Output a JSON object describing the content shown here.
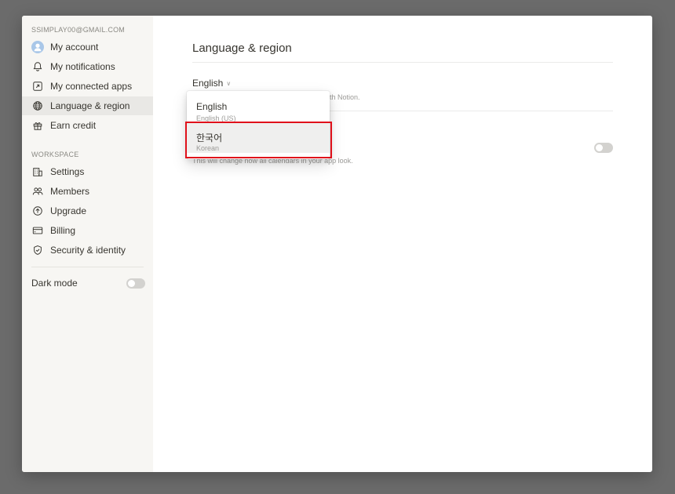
{
  "sidebar": {
    "account_email": "SSIMPLAY00@GMAIL.COM",
    "account_items": [
      {
        "label": "My account",
        "icon": "avatar-icon"
      },
      {
        "label": "My notifications",
        "icon": "bell-icon"
      },
      {
        "label": "My connected apps",
        "icon": "external-link-icon"
      },
      {
        "label": "Language & region",
        "icon": "globe-icon",
        "active": true
      },
      {
        "label": "Earn credit",
        "icon": "gift-icon"
      }
    ],
    "workspace_label": "WORKSPACE",
    "workspace_items": [
      {
        "label": "Settings",
        "icon": "building-icon"
      },
      {
        "label": "Members",
        "icon": "people-icon"
      },
      {
        "label": "Upgrade",
        "icon": "upgrade-circle-icon"
      },
      {
        "label": "Billing",
        "icon": "card-icon"
      },
      {
        "label": "Security & identity",
        "icon": "shield-check-icon"
      }
    ],
    "dark_mode_label": "Dark mode",
    "dark_mode_on": false
  },
  "main": {
    "title": "Language & region",
    "language_value": "English",
    "language_desc_visible": "th Notion.",
    "calendar_desc": "This will change how all calendars in your app look.",
    "calendar_toggle_on": false
  },
  "dropdown": {
    "options": [
      {
        "label": "English",
        "sublabel": "English (US)"
      },
      {
        "label": "한국어",
        "sublabel": "Korean",
        "highlighted": true
      }
    ]
  },
  "colors": {
    "sidebar_bg": "#f7f6f3",
    "active_item_bg": "#e9e8e5",
    "highlight_border": "#e0111b",
    "backdrop": "#6b6b6b"
  }
}
